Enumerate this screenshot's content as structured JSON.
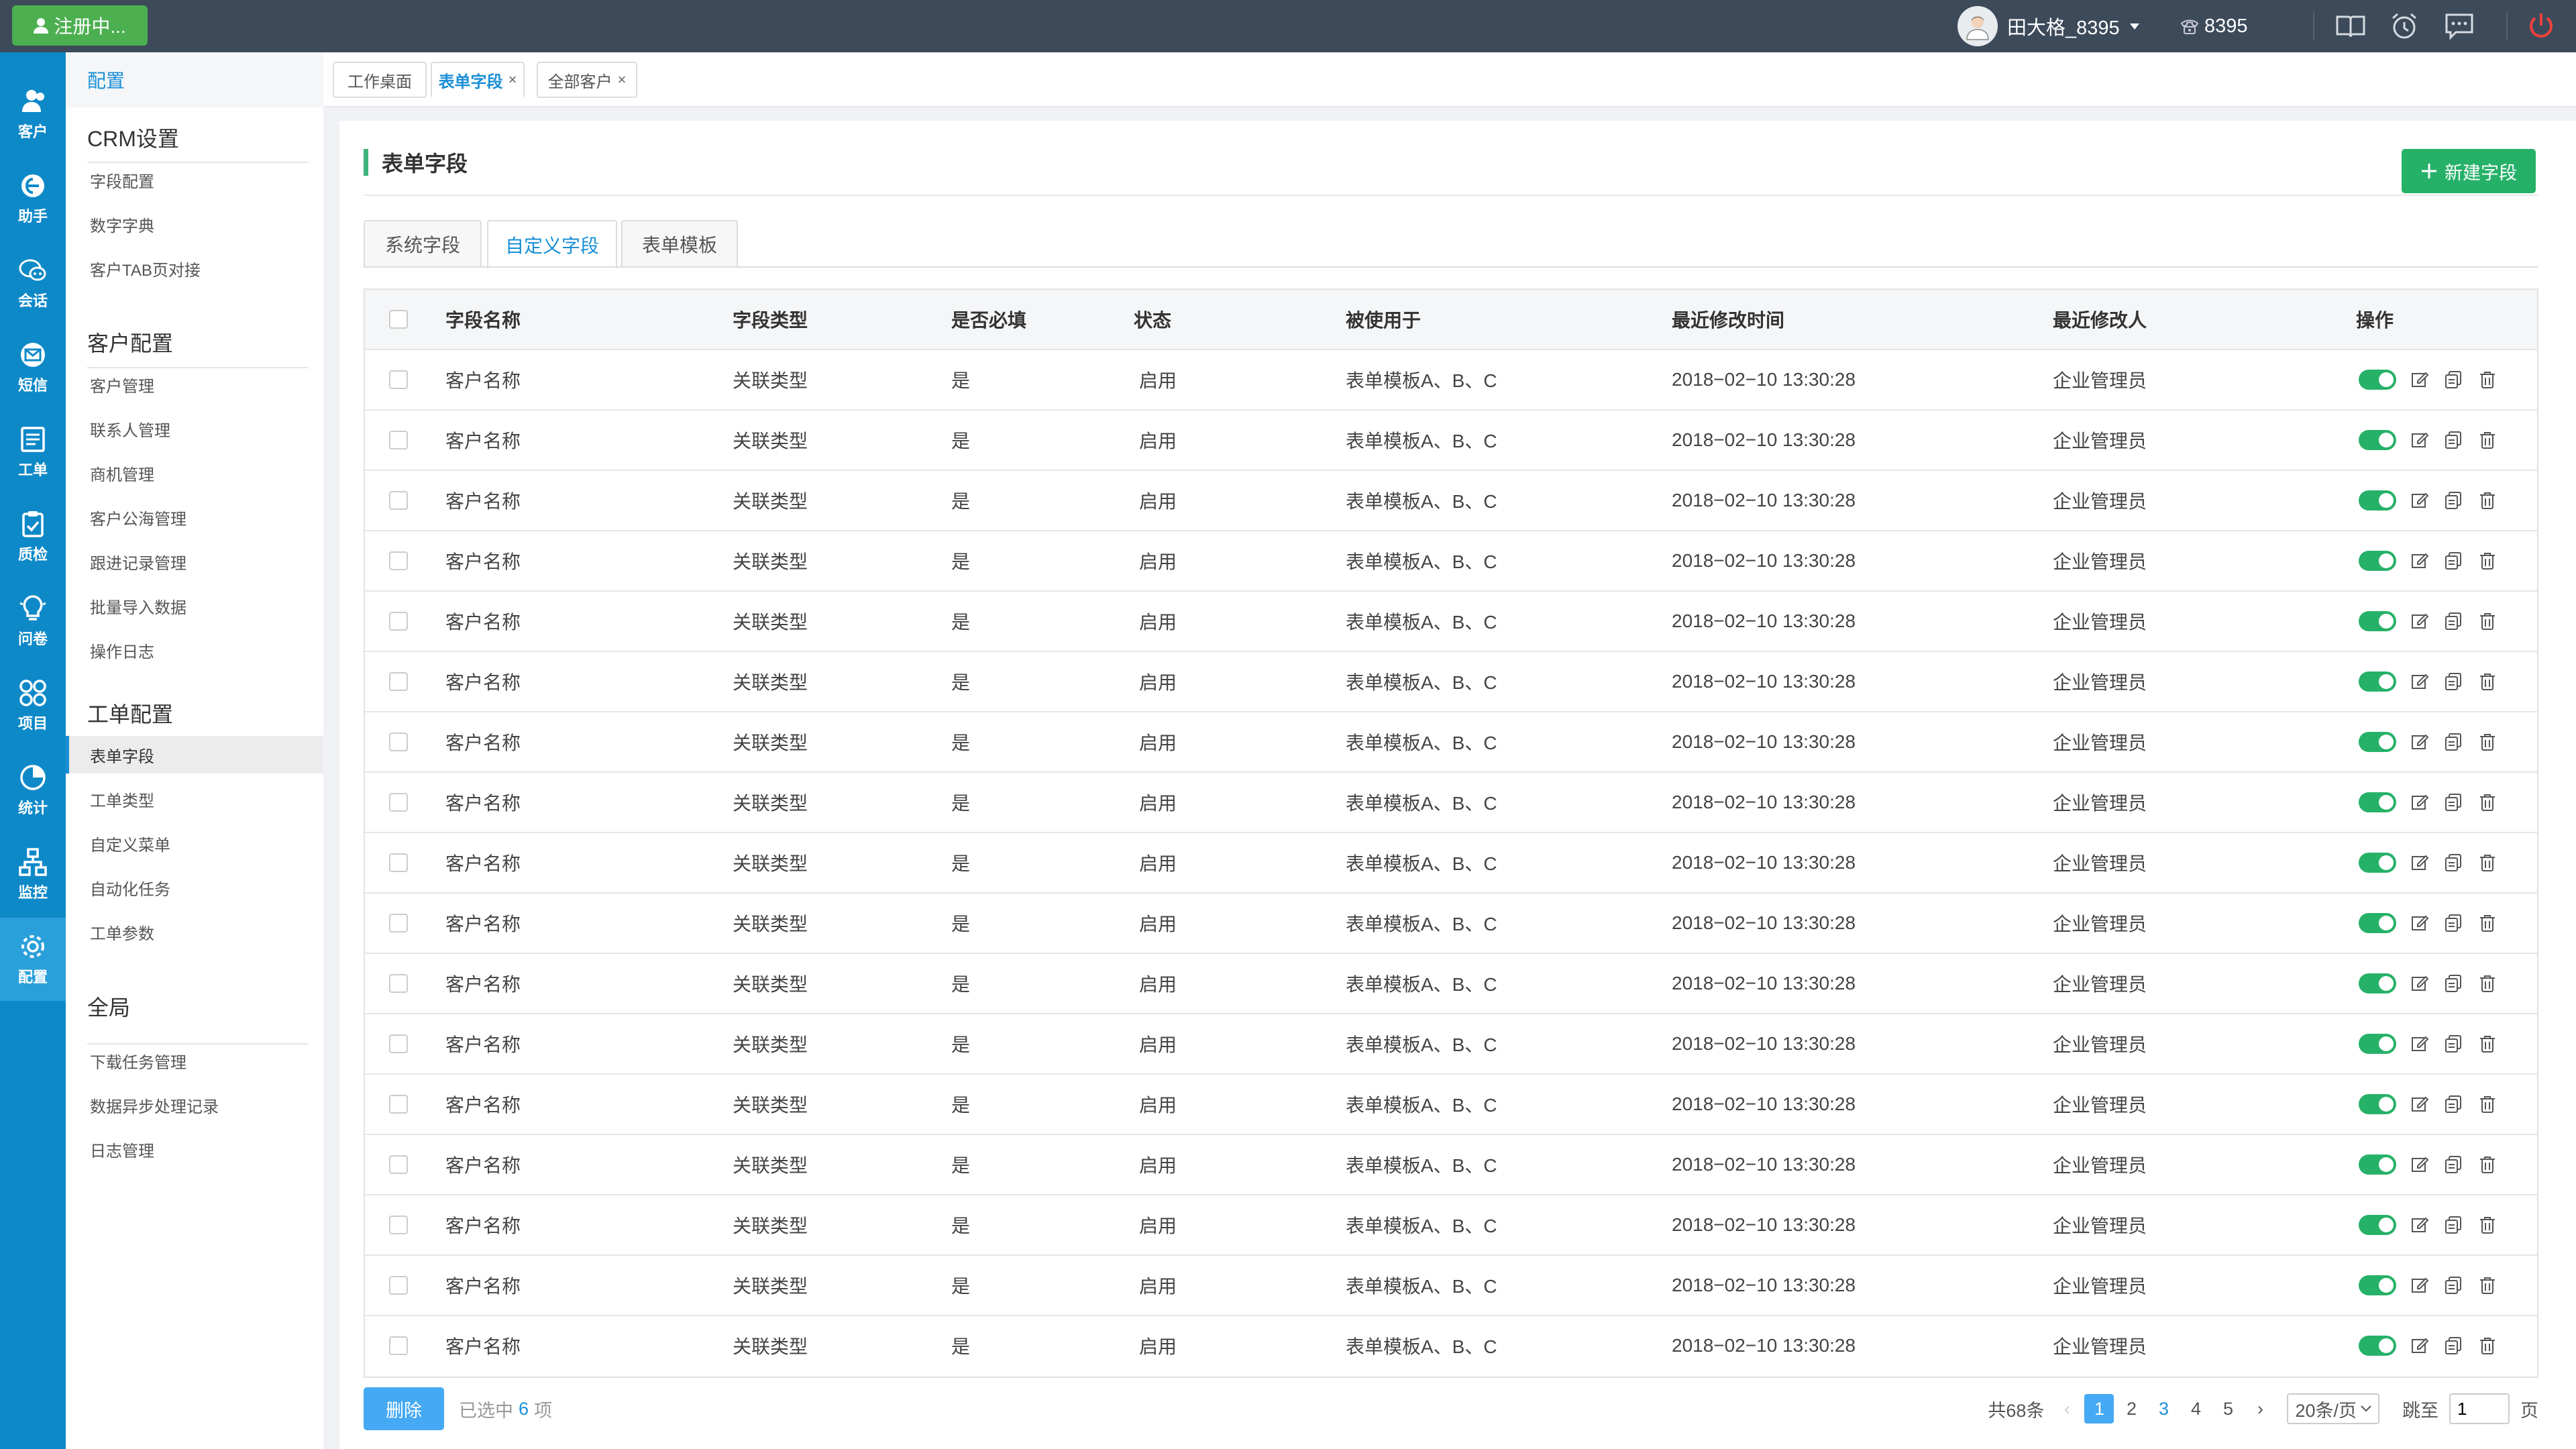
{
  "topbar": {
    "register_label": "注册中...",
    "user_name": "田大格_8395",
    "extension": "8395"
  },
  "nav": [
    {
      "label": "客户",
      "icon": "customers-icon"
    },
    {
      "label": "助手",
      "icon": "assistant-icon"
    },
    {
      "label": "会话",
      "icon": "chat-icon"
    },
    {
      "label": "短信",
      "icon": "sms-icon"
    },
    {
      "label": "工单",
      "icon": "ticket-icon"
    },
    {
      "label": "质检",
      "icon": "quality-check-icon"
    },
    {
      "label": "问卷",
      "icon": "survey-icon"
    },
    {
      "label": "项目",
      "icon": "project-icon"
    },
    {
      "label": "统计",
      "icon": "stats-icon"
    },
    {
      "label": "监控",
      "icon": "monitor-icon"
    },
    {
      "label": "配置",
      "icon": "settings-icon",
      "active": true
    }
  ],
  "sidebar": {
    "header": "配置",
    "sections": [
      {
        "title": "CRM设置",
        "items": [
          "字段配置",
          "数字字典",
          "客户TAB页对接"
        ]
      },
      {
        "title": "客户配置",
        "items": [
          "客户管理",
          "联系人管理",
          "商机管理",
          "客户公海管理",
          "跟进记录管理",
          "批量导入数据",
          "操作日志"
        ]
      },
      {
        "title": "工单配置",
        "items": [
          "表单字段",
          "工单类型",
          "自定义菜单",
          "自动化任务",
          "工单参数"
        ]
      },
      {
        "title": "全局",
        "items": [
          "下载任务管理",
          "数据异步处理记录",
          "日志管理"
        ]
      }
    ],
    "active_item": "表单字段"
  },
  "page_tabs": [
    {
      "label": "工作桌面",
      "closable": false
    },
    {
      "label": "表单字段",
      "closable": true,
      "active": true
    },
    {
      "label": "全部客户",
      "closable": true
    }
  ],
  "main": {
    "title": "表单字段",
    "new_button": "新建字段",
    "field_tabs": [
      "系统字段",
      "自定义字段",
      "表单模板"
    ],
    "active_field_tab": "自定义字段",
    "columns": [
      "字段名称",
      "字段类型",
      "是否必填",
      "状态",
      "被使用于",
      "最近修改时间",
      "最近修改人",
      "操作"
    ],
    "rows": [
      [
        "客户名称",
        "关联类型",
        "是",
        "启用",
        "表单模板A、B、C",
        "2018−02−10 13:30:28",
        "企业管理员"
      ],
      [
        "客户名称",
        "关联类型",
        "是",
        "启用",
        "表单模板A、B、C",
        "2018−02−10 13:30:28",
        "企业管理员"
      ],
      [
        "客户名称",
        "关联类型",
        "是",
        "启用",
        "表单模板A、B、C",
        "2018−02−10 13:30:28",
        "企业管理员"
      ],
      [
        "客户名称",
        "关联类型",
        "是",
        "启用",
        "表单模板A、B、C",
        "2018−02−10 13:30:28",
        "企业管理员"
      ],
      [
        "客户名称",
        "关联类型",
        "是",
        "启用",
        "表单模板A、B、C",
        "2018−02−10 13:30:28",
        "企业管理员"
      ],
      [
        "客户名称",
        "关联类型",
        "是",
        "启用",
        "表单模板A、B、C",
        "2018−02−10 13:30:28",
        "企业管理员"
      ],
      [
        "客户名称",
        "关联类型",
        "是",
        "启用",
        "表单模板A、B、C",
        "2018−02−10 13:30:28",
        "企业管理员"
      ],
      [
        "客户名称",
        "关联类型",
        "是",
        "启用",
        "表单模板A、B、C",
        "2018−02−10 13:30:28",
        "企业管理员"
      ],
      [
        "客户名称",
        "关联类型",
        "是",
        "启用",
        "表单模板A、B、C",
        "2018−02−10 13:30:28",
        "企业管理员"
      ],
      [
        "客户名称",
        "关联类型",
        "是",
        "启用",
        "表单模板A、B、C",
        "2018−02−10 13:30:28",
        "企业管理员"
      ],
      [
        "客户名称",
        "关联类型",
        "是",
        "启用",
        "表单模板A、B、C",
        "2018−02−10 13:30:28",
        "企业管理员"
      ],
      [
        "客户名称",
        "关联类型",
        "是",
        "启用",
        "表单模板A、B、C",
        "2018−02−10 13:30:28",
        "企业管理员"
      ],
      [
        "客户名称",
        "关联类型",
        "是",
        "启用",
        "表单模板A、B、C",
        "2018−02−10 13:30:28",
        "企业管理员"
      ],
      [
        "客户名称",
        "关联类型",
        "是",
        "启用",
        "表单模板A、B、C",
        "2018−02−10 13:30:28",
        "企业管理员"
      ],
      [
        "客户名称",
        "关联类型",
        "是",
        "启用",
        "表单模板A、B、C",
        "2018−02−10 13:30:28",
        "企业管理员"
      ],
      [
        "客户名称",
        "关联类型",
        "是",
        "启用",
        "表单模板A、B、C",
        "2018−02−10 13:30:28",
        "企业管理员"
      ],
      [
        "客户名称",
        "关联类型",
        "是",
        "启用",
        "表单模板A、B、C",
        "2018−02−10 13:30:28",
        "企业管理员"
      ]
    ]
  },
  "footer": {
    "delete_label": "删除",
    "selected_prefix": "已选中",
    "selected_count": "6",
    "selected_suffix": "项",
    "total_label": "共68条",
    "pages": [
      "1",
      "2",
      "3",
      "4",
      "5"
    ],
    "current_page": "1",
    "page_size": "20条/页",
    "jump_label": "跳至",
    "jump_value": "1",
    "page_unit": "页"
  },
  "colors": {
    "nav_bg": "#0e89c8",
    "topbar_bg": "#3c4a5a",
    "accent_green": "#26b168",
    "accent_blue": "#1a8fd6"
  }
}
